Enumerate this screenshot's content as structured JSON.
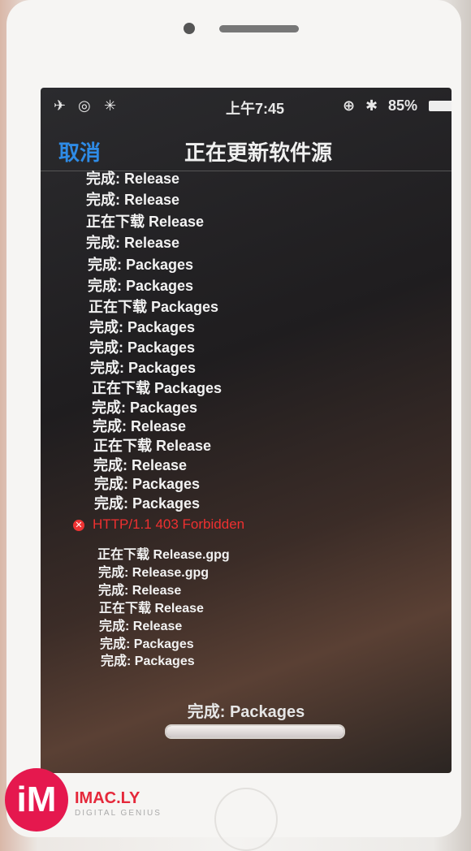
{
  "status_bar": {
    "time": "上午7:45",
    "battery": "85%",
    "icons": [
      "airplane-icon",
      "wifi-icon",
      "activity-spinner-icon",
      "orientation-lock-icon",
      "bluetooth-icon",
      "battery-icon"
    ]
  },
  "nav": {
    "cancel_label": "取消",
    "title": "正在更新软件源"
  },
  "log": [
    {
      "text": "完成: Release"
    },
    {
      "text": "完成: Release"
    },
    {
      "text": "正在下载 Release"
    },
    {
      "text": "完成: Release"
    },
    {
      "text": "完成: Packages"
    },
    {
      "text": "完成: Packages"
    },
    {
      "text": "正在下载 Packages"
    },
    {
      "text": "完成: Packages"
    },
    {
      "text": "完成: Packages"
    },
    {
      "text": "完成: Packages"
    },
    {
      "text": "正在下载 Packages"
    },
    {
      "text": "完成: Packages"
    },
    {
      "text": "完成: Release"
    },
    {
      "text": "正在下载 Release"
    },
    {
      "text": "完成: Release"
    },
    {
      "text": "完成: Packages"
    },
    {
      "text": "完成: Packages"
    },
    {
      "text": "HTTP/1.1 403 Forbidden",
      "error": true
    },
    {
      "text": "正在下载 Release.gpg"
    },
    {
      "text": "完成: Release.gpg"
    },
    {
      "text": "完成: Release"
    },
    {
      "text": "正在下载 Release"
    },
    {
      "text": "完成: Release"
    },
    {
      "text": "完成: Packages"
    },
    {
      "text": "完成: Packages"
    }
  ],
  "progress": {
    "message": "完成: Packages",
    "value": 1.0
  },
  "watermark": {
    "logo": "iM",
    "brand": "IMAC.LY",
    "tagline": "DIGITAL GENIUS"
  },
  "colors": {
    "accent": "#2e8be6",
    "error": "#ee3030"
  }
}
